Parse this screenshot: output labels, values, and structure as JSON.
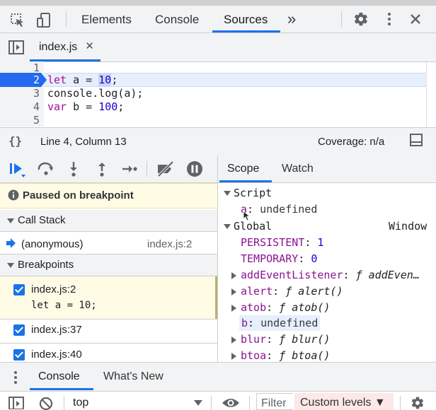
{
  "toolbar": {
    "tabs": [
      "Elements",
      "Console",
      "Sources"
    ],
    "active_tab": "Sources",
    "more_label": "»"
  },
  "file_tab": {
    "name": "index.js",
    "close": "×"
  },
  "editor": {
    "lines": [
      {
        "num": "1",
        "text": ""
      },
      {
        "num": "2",
        "kw": "let",
        "rest_pre": " a = ",
        "num_val": "10",
        "rest_post": ";"
      },
      {
        "num": "3",
        "text": "console.log(a);"
      },
      {
        "num": "4",
        "kw": "var",
        "rest_pre": " b = ",
        "num_val": "100",
        "rest_post": ";"
      },
      {
        "num": "5",
        "text": ""
      }
    ]
  },
  "status": {
    "braces": "{}",
    "position": "Line 4, Column 13",
    "coverage": "Coverage: n/a"
  },
  "scope_tabs": [
    "Scope",
    "Watch"
  ],
  "paused_text": "Paused on breakpoint",
  "call_stack": {
    "title": "Call Stack",
    "frame_name": "(anonymous)",
    "frame_loc": "index.js:2"
  },
  "breakpoints": {
    "title": "Breakpoints",
    "items": [
      {
        "loc": "index.js:2",
        "code": "let a = 10;"
      },
      {
        "loc": "index.js:37"
      },
      {
        "loc": "index.js:40"
      }
    ]
  },
  "scope": {
    "script_label": "Script",
    "script_vars": [
      {
        "name": "a",
        "value": "undefined"
      }
    ],
    "global_label": "Global",
    "global_value": "Window",
    "global_vars": [
      {
        "name": "PERSISTENT",
        "value": "1"
      },
      {
        "name": "TEMPORARY",
        "value": "0"
      },
      {
        "name": "addEventListener",
        "f": "ƒ",
        "value": "addEven…"
      },
      {
        "name": "alert",
        "f": "ƒ",
        "value": "alert()"
      },
      {
        "name": "atob",
        "f": "ƒ",
        "value": "atob()"
      },
      {
        "name": "b",
        "value": "undefined"
      },
      {
        "name": "blur",
        "f": "ƒ",
        "value": "blur()"
      },
      {
        "name": "btoa",
        "f": "ƒ",
        "value": "btoa()"
      }
    ]
  },
  "drawer": {
    "tabs": [
      "Console",
      "What's New"
    ],
    "context": "top",
    "filter": "Filter",
    "levels": "Custom levels ▼"
  },
  "colors": {
    "accent": "#1a73e8",
    "breakpoint": "#2469f0",
    "paused_bg": "#fffbe5",
    "keyword": "#aa0d91",
    "number": "#1c00cf",
    "property": "#881391"
  }
}
